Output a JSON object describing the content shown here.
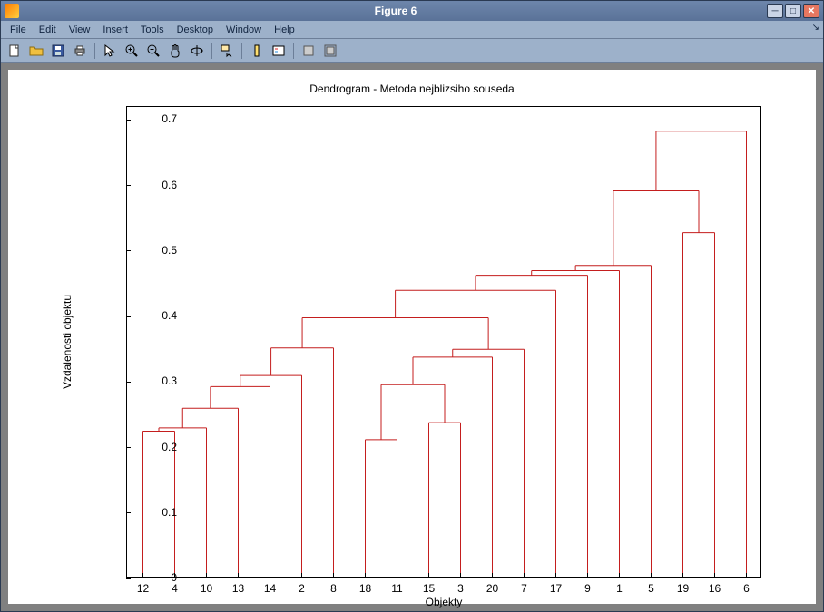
{
  "window": {
    "title": "Figure 6"
  },
  "menu": {
    "file": "File",
    "edit": "Edit",
    "view": "View",
    "insert": "Insert",
    "tools": "Tools",
    "desktop": "Desktop",
    "window": "Window",
    "help": "Help"
  },
  "toolbar": {
    "new": "New",
    "open": "Open",
    "save": "Save",
    "print": "Print",
    "pointer": "Edit Plot",
    "zoomin": "Zoom In",
    "zoomout": "Zoom Out",
    "pan": "Pan",
    "rotate": "Rotate 3D",
    "datacursor": "Data Cursor",
    "colorbar": "Insert Colorbar",
    "legend": "Insert Legend",
    "hide": "Hide Plot Tools",
    "show": "Show Plot Tools"
  },
  "chart_data": {
    "type": "dendrogram",
    "title": "Dendrogram - Metoda nejblizsiho souseda",
    "xlabel": "Objekty",
    "ylabel": "Vzdalenosti objektu",
    "ylim": [
      0,
      0.72
    ],
    "yticks": [
      0,
      0.1,
      0.2,
      0.3,
      0.4,
      0.5,
      0.6,
      0.7
    ],
    "xtick_labels": [
      "12",
      "4",
      "10",
      "13",
      "14",
      "2",
      "8",
      "18",
      "11",
      "15",
      "3",
      "20",
      "7",
      "17",
      "9",
      "1",
      "5",
      "19",
      "16",
      "6"
    ],
    "merges": [
      {
        "left_x": 1,
        "right_x": 2,
        "height": 0.225,
        "leaves_left": true,
        "leaves_right": true,
        "x_out": 1.5
      },
      {
        "left_x": 1.5,
        "right_x": 3,
        "height": 0.23,
        "h_left": 0.225,
        "leaves_right": true,
        "x_out": 2.25
      },
      {
        "left_x": 2.25,
        "right_x": 4,
        "height": 0.26,
        "h_left": 0.23,
        "leaves_right": true,
        "x_out": 3.125
      },
      {
        "left_x": 3.125,
        "right_x": 5,
        "height": 0.293,
        "h_left": 0.26,
        "leaves_right": true,
        "x_out": 4.0625
      },
      {
        "left_x": 4.0625,
        "right_x": 6,
        "height": 0.31,
        "h_left": 0.293,
        "leaves_right": true,
        "x_out": 5.031
      },
      {
        "left_x": 5.031,
        "right_x": 7,
        "height": 0.352,
        "h_left": 0.31,
        "leaves_right": true,
        "x_out": 6.016
      },
      {
        "left_x": 8,
        "right_x": 9,
        "height": 0.212,
        "leaves_left": true,
        "leaves_right": true,
        "x_out": 8.5
      },
      {
        "left_x": 10,
        "right_x": 11,
        "height": 0.238,
        "leaves_left": true,
        "leaves_right": true,
        "x_out": 10.5
      },
      {
        "left_x": 8.5,
        "right_x": 10.5,
        "height": 0.296,
        "h_left": 0.212,
        "h_right": 0.238,
        "x_out": 9.5
      },
      {
        "left_x": 9.5,
        "right_x": 12,
        "height": 0.338,
        "h_left": 0.296,
        "leaves_right": true,
        "x_out": 10.75
      },
      {
        "left_x": 10.75,
        "right_x": 13,
        "height": 0.35,
        "h_left": 0.338,
        "leaves_right": true,
        "x_out": 11.875
      },
      {
        "left_x": 6.016,
        "right_x": 11.875,
        "height": 0.398,
        "h_left": 0.352,
        "h_right": 0.35,
        "x_out": 8.9455
      },
      {
        "left_x": 8.9455,
        "right_x": 14,
        "height": 0.44,
        "h_left": 0.398,
        "leaves_right": true,
        "x_out": 11.47
      },
      {
        "left_x": 11.47,
        "right_x": 15,
        "height": 0.463,
        "h_left": 0.44,
        "leaves_right": true,
        "x_out": 13.235
      },
      {
        "left_x": 13.235,
        "right_x": 16,
        "height": 0.47,
        "h_left": 0.463,
        "leaves_right": true,
        "x_out": 14.618
      },
      {
        "left_x": 14.618,
        "right_x": 17,
        "height": 0.478,
        "h_left": 0.47,
        "leaves_right": true,
        "x_out": 15.809
      },
      {
        "left_x": 18,
        "right_x": 19,
        "height": 0.528,
        "leaves_left": true,
        "leaves_right": true,
        "x_out": 18.5
      },
      {
        "left_x": 15.809,
        "right_x": 18.5,
        "height": 0.592,
        "h_left": 0.478,
        "h_right": 0.528,
        "x_out": 17.155
      },
      {
        "left_x": 17.155,
        "right_x": 20,
        "height": 0.683,
        "h_left": 0.592,
        "leaves_right": true,
        "x_out": 18.577
      }
    ]
  }
}
